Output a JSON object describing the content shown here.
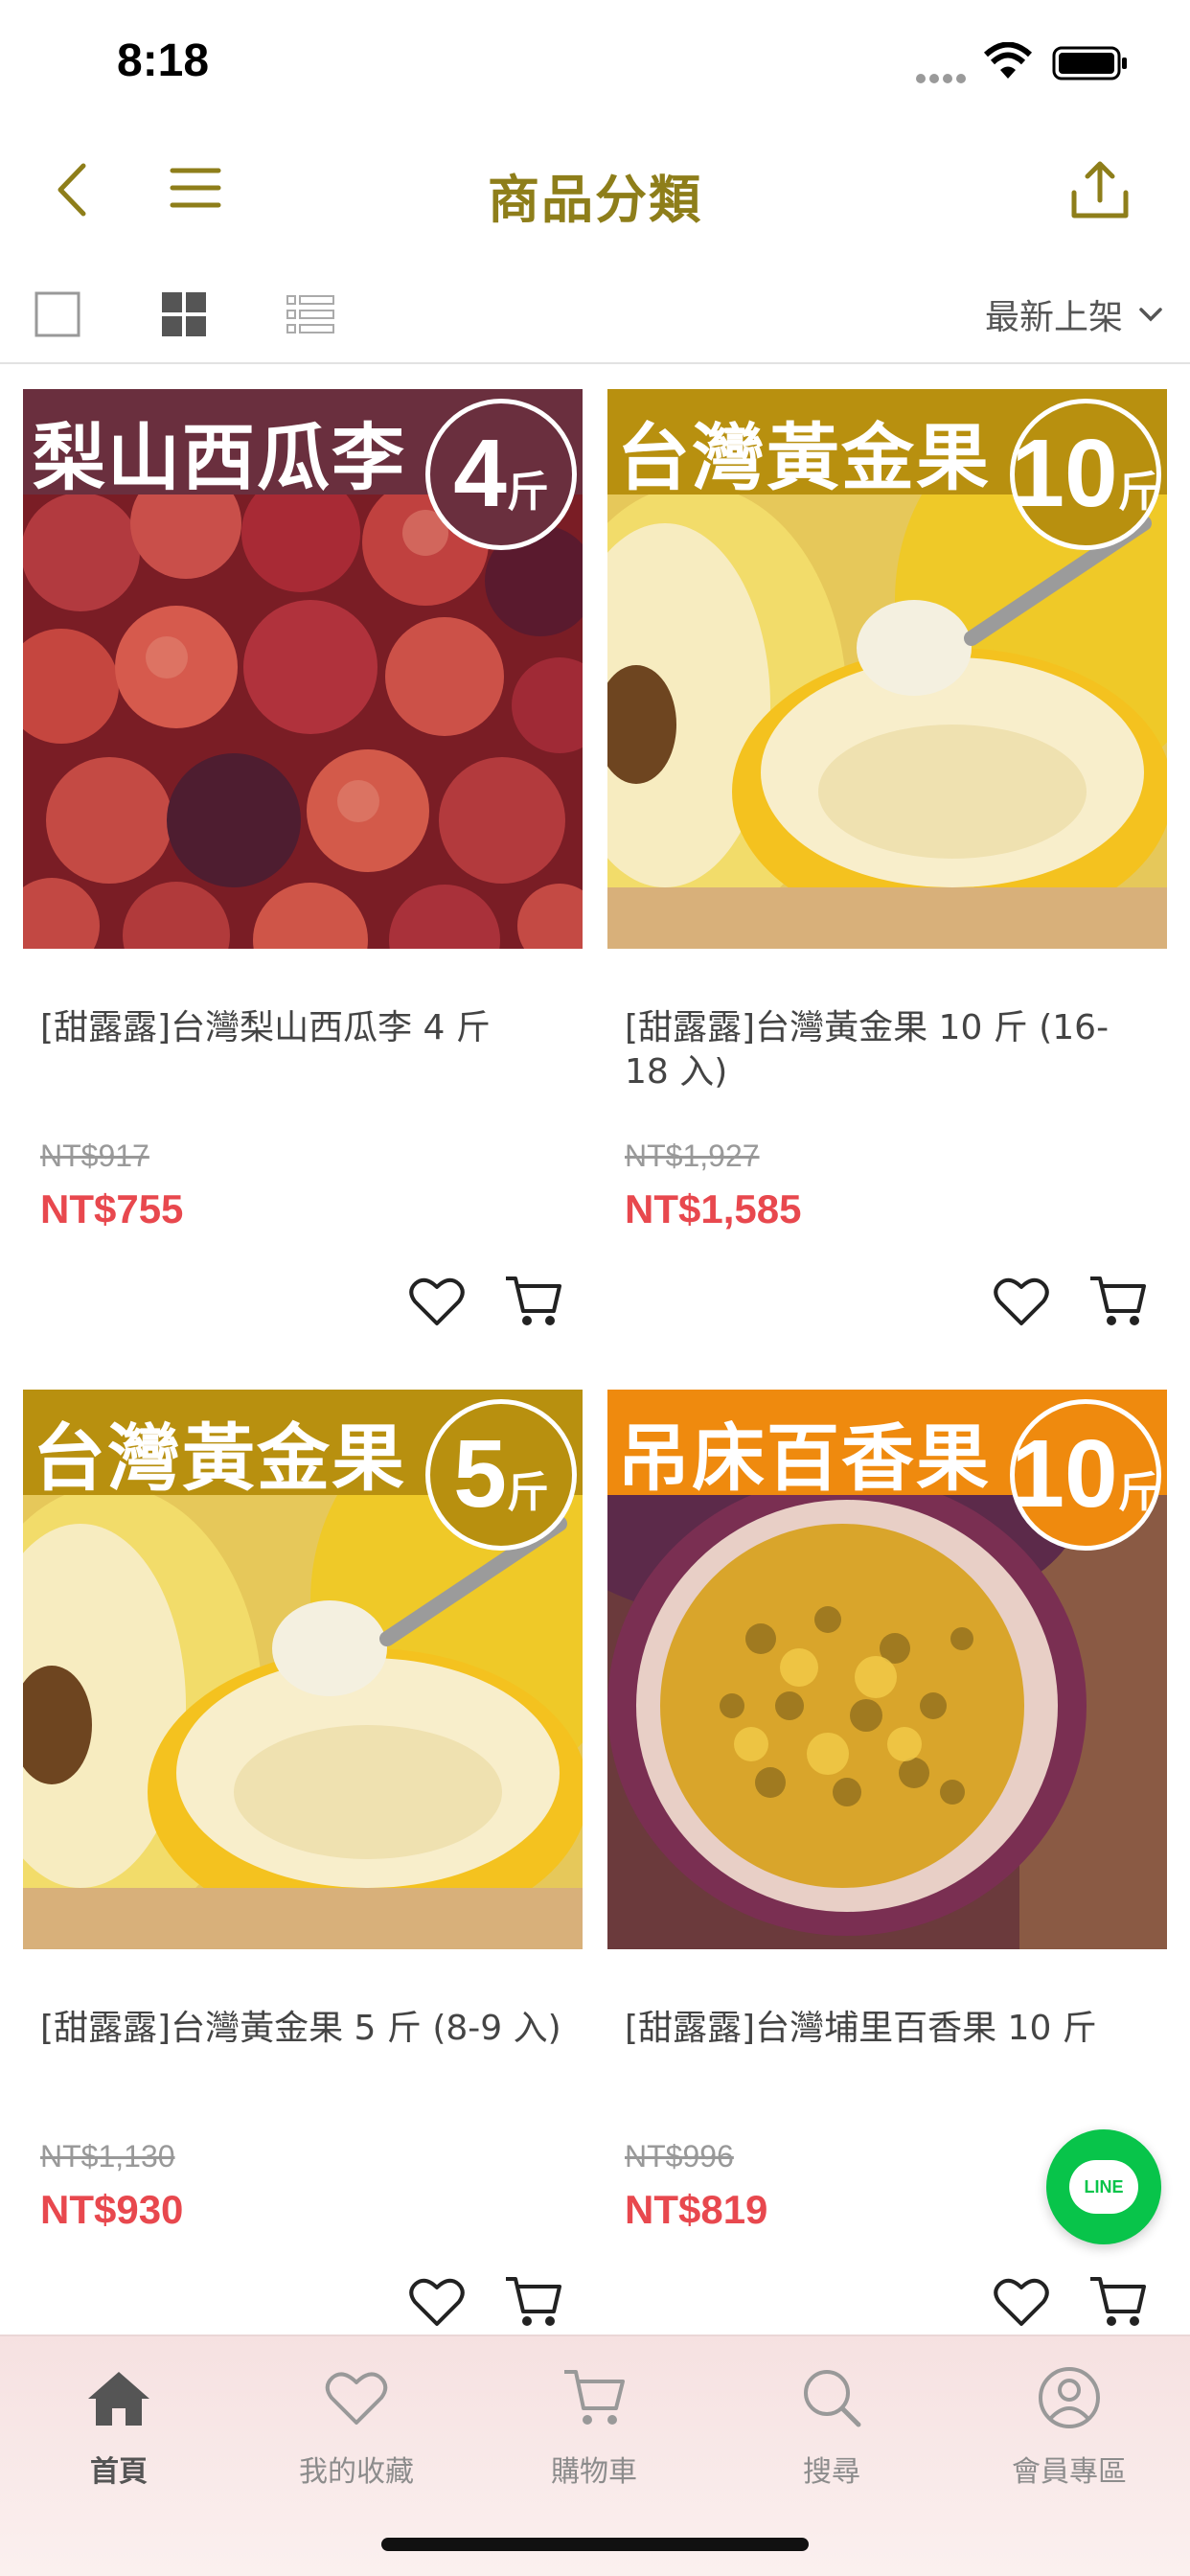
{
  "status_bar": {
    "time": "8:18"
  },
  "header": {
    "title": "商品分類"
  },
  "toolbar": {
    "sort_label": "最新上架"
  },
  "products": [
    {
      "banner": "梨山西瓜李",
      "badge_num": "4",
      "badge_unit": "斤",
      "banner_color": "#6a2f3e",
      "name": "[甜露露]台灣梨山西瓜李 4 斤",
      "original_price": "NT$917",
      "price": "NT$755"
    },
    {
      "banner": "台灣黃金果",
      "badge_num": "10",
      "badge_unit": "斤",
      "banner_color": "#b8900f",
      "name": "[甜露露]台灣黃金果 10 斤 (16-18 入)",
      "original_price": "NT$1,927",
      "price": "NT$1,585"
    },
    {
      "banner": "台灣黃金果",
      "badge_num": "5",
      "badge_unit": "斤",
      "banner_color": "#b8900f",
      "name": "[甜露露]台灣黃金果 5 斤 (8-9 入)",
      "original_price": "NT$1,130",
      "price": "NT$930"
    },
    {
      "banner": "吊床百香果",
      "badge_num": "10",
      "badge_unit": "斤",
      "banner_color": "#ef8a0e",
      "name": "[甜露露]台灣埔里百香果 10 斤",
      "original_price": "NT$996",
      "price": "NT$819"
    }
  ],
  "line_button": {
    "label": "LINE"
  },
  "tab_bar": {
    "tabs": [
      {
        "label": "首頁",
        "icon": "home-icon"
      },
      {
        "label": "我的收藏",
        "icon": "heart-icon"
      },
      {
        "label": "購物車",
        "icon": "cart-icon"
      },
      {
        "label": "搜尋",
        "icon": "search-icon"
      },
      {
        "label": "會員專區",
        "icon": "user-icon"
      }
    ]
  },
  "colors": {
    "accent": "#8e7e1a",
    "price": "#e8484e",
    "line": "#08c44a"
  }
}
